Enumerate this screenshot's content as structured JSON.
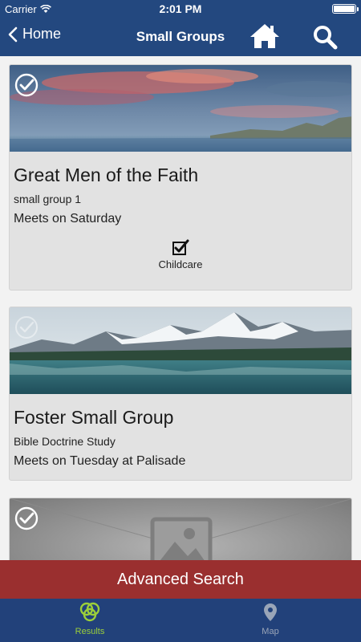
{
  "status_bar": {
    "carrier": "Carrier",
    "time": "2:01 PM"
  },
  "nav": {
    "back_label": "Home",
    "title": "Small Groups"
  },
  "groups": [
    {
      "name": "Great Men of the Faith",
      "description": "small group 1",
      "meets": "Meets on Saturday",
      "amenity": "Childcare",
      "selected": true,
      "image": "sunset-seascape-photo"
    },
    {
      "name": "Foster Small Group",
      "description": "Bible Doctrine Study",
      "meets": "Meets on Tuesday at Palisade",
      "selected": false,
      "image": "mountain-lake-photo"
    },
    {
      "selected": true,
      "image": "placeholder-image"
    }
  ],
  "advanced_search": {
    "label": "Advanced Search"
  },
  "tabs": [
    {
      "label": "Results",
      "icon": "results-rings-icon",
      "active": true
    },
    {
      "label": "Map",
      "icon": "map-pin-icon",
      "active": false
    }
  ],
  "colors": {
    "nav_bg": "#23487f",
    "tab_bg": "#22417a",
    "advanced_search_bg": "#9a2f2f",
    "active_tab": "#9ccf3a",
    "inactive_tab": "#9aa5b8"
  }
}
